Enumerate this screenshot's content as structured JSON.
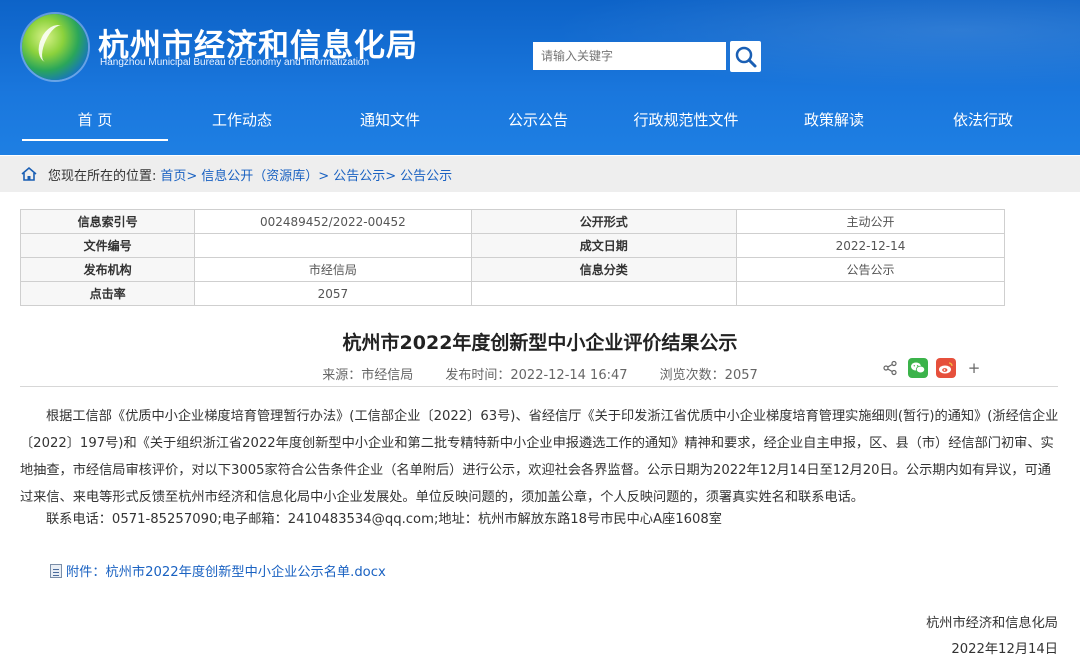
{
  "header": {
    "site_title": "杭州市经济和信息化局",
    "site_subtitle": "Hangzhou Municipal Bureau of Economy and Informatization",
    "search_placeholder": "请输入关键字",
    "brand_color": "#0d63c8"
  },
  "nav": {
    "items": [
      {
        "label": "首 页",
        "active": true
      },
      {
        "label": "工作动态"
      },
      {
        "label": "通知文件"
      },
      {
        "label": "公示公告"
      },
      {
        "label": "行政规范性文件"
      },
      {
        "label": "政策解读"
      },
      {
        "label": "依法行政"
      }
    ]
  },
  "breadcrumb": {
    "prefix": "您现在所在的位置:",
    "items": [
      "首页>",
      "信息公开（资源库）>",
      "公告公示>",
      "公告公示"
    ]
  },
  "info_table": {
    "rows": [
      {
        "k1": "信息索引号",
        "v1": "002489452/2022-00452",
        "k2": "公开形式",
        "v2": "主动公开"
      },
      {
        "k1": "文件编号",
        "v1": "",
        "k2": "成文日期",
        "v2": "2022-12-14"
      },
      {
        "k1": "发布机构",
        "v1": "市经信局",
        "k2": "信息分类",
        "v2": "公告公示"
      },
      {
        "k1": "点击率",
        "v1": "2057",
        "k2": "",
        "v2": ""
      }
    ]
  },
  "article": {
    "title": "杭州市2022年度创新型中小企业评价结果公示",
    "source": "来源：市经信局",
    "published": "发布时间：2022-12-14 16:47",
    "views": "浏览次数：2057",
    "body": "根据工信部《优质中小企业梯度培育管理暂行办法》(工信部企业〔2022〕63号)、省经信厅《关于印发浙江省优质中小企业梯度培育管理实施细则(暂行)的通知》(浙经信企业〔2022〕197号)和《关于组织浙江省2022年度创新型中小企业和第二批专精特新中小企业申报遴选工作的通知》精神和要求，经企业自主申报，区、县（市）经信部门初审、实地抽查，市经信局审核评价，对以下3005家符合公告条件企业（名单附后）进行公示，欢迎社会各界监督。公示日期为2022年12月14日至12月20日。公示期内如有异议，可通过来信、来电等形式反馈至杭州市经济和信息化局中小企业发展处。单位反映问题的，须加盖公章，个人反映问题的，须署真实姓名和联系电话。",
    "contact": "联系电话：0571-85257090;电子邮箱：2410483534@qq.com;地址：杭州市解放东路18号市民中心A座1608室",
    "attachment": "附件：杭州市2022年度创新型中小企业公示名单.docx",
    "signature": "杭州市经济和信息化局",
    "date": "2022年12月14日"
  },
  "share": {
    "icons": [
      "share-icon",
      "wechat-icon",
      "weibo-icon",
      "plus-icon"
    ],
    "plus": "+",
    "wechat_color": "#3bb34a",
    "weibo_color": "#e6503c"
  }
}
